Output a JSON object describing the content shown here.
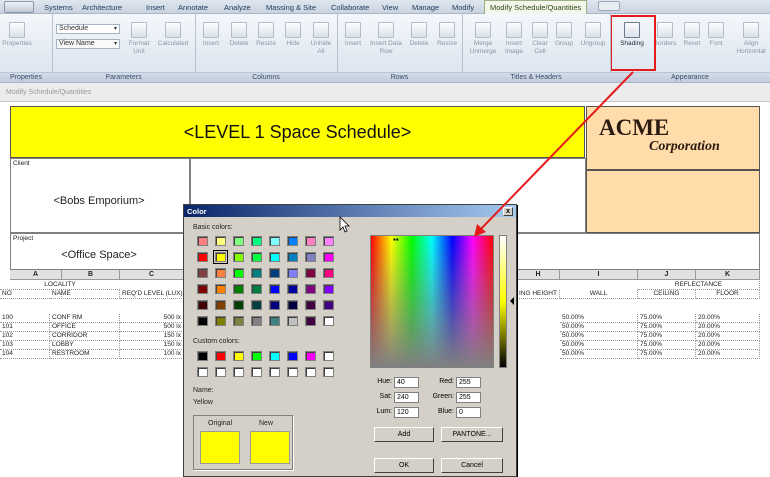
{
  "menubar": {
    "items": [
      "Systems",
      "Architecture",
      "Insert",
      "Annotate",
      "Analyze",
      "Massing & Site",
      "Collaborate",
      "View",
      "Manage",
      "Modify"
    ],
    "active": "Modify Schedule/Quantities"
  },
  "ribbon": {
    "properties_label": "Properties",
    "schedule_dropdown": "Schedule",
    "view_name_field": "View Name",
    "parameters": [
      "Format Unit",
      "Calculated"
    ],
    "columns": [
      "Insert",
      "Delete",
      "Resize",
      "Hide",
      "Unhide All"
    ],
    "rows": [
      "Insert",
      "Insert Data Row",
      "Delete",
      "Resize"
    ],
    "titles": [
      "Merge Unmerge",
      "Insert Image",
      "Clear Cell",
      "Group",
      "Ungroup"
    ],
    "appearance": [
      "Shading",
      "Borders",
      "Reset",
      "Font",
      "Align Horizontal"
    ],
    "panels": [
      "Properties",
      "Parameters",
      "Columns",
      "Rows",
      "Titles & Headers",
      "Appearance"
    ]
  },
  "context_label": "Modify Schedule/Quantities",
  "schedule": {
    "title": "<LEVEL 1 Space Schedule>",
    "logo_line1": "ACME",
    "logo_line2": "Corporation",
    "client_label": "Client",
    "client_value": "<Bobs Emporium>",
    "project_label": "Project",
    "project_value": "<Office Space>",
    "column_letters": [
      "A",
      "B",
      "C",
      "H",
      "I",
      "J",
      "K"
    ],
    "locality": "LOCALITY",
    "reflectance": "REFLECTANCE",
    "headers": [
      "NO",
      "NAME",
      "REQ'D LEVEL (LUX)",
      "ING HEIGHT",
      "WALL",
      "CEILING",
      "FLOOR"
    ],
    "rows": [
      {
        "no": "100",
        "name": "CONF RM",
        "lux": "500 lx",
        "wall": "50.00%",
        "ceiling": "75.00%",
        "floor": "20.00%"
      },
      {
        "no": "101",
        "name": "OFFICE",
        "lux": "500 lx",
        "wall": "50.00%",
        "ceiling": "75.00%",
        "floor": "20.00%"
      },
      {
        "no": "102",
        "name": "CORRIDOR",
        "lux": "150 lx",
        "wall": "50.00%",
        "ceiling": "75.00%",
        "floor": "20.00%"
      },
      {
        "no": "103",
        "name": "LOBBY",
        "lux": "150 lx",
        "wall": "50.00%",
        "ceiling": "75.00%",
        "floor": "20.00%"
      },
      {
        "no": "104",
        "name": "RESTROOM",
        "lux": "100 lx",
        "wall": "50.00%",
        "ceiling": "75.00%",
        "floor": "20.00%"
      }
    ]
  },
  "dialog": {
    "title": "Color",
    "close": "x",
    "basic_label": "Basic colors:",
    "custom_label": "Custom colors:",
    "basic_colors": [
      "#ff8080",
      "#ffff80",
      "#80ff80",
      "#00ff80",
      "#80ffff",
      "#0080ff",
      "#ff80c0",
      "#ff80ff",
      "#ff0000",
      "#ffff00",
      "#80ff00",
      "#00ff40",
      "#00ffff",
      "#0080c0",
      "#8080c0",
      "#ff00ff",
      "#804040",
      "#ff8040",
      "#00ff00",
      "#008080",
      "#004080",
      "#8080ff",
      "#800040",
      "#ff0080",
      "#800000",
      "#ff8000",
      "#008000",
      "#008040",
      "#0000ff",
      "#0000a0",
      "#800080",
      "#8000ff",
      "#400000",
      "#804000",
      "#004000",
      "#004040",
      "#000080",
      "#000040",
      "#400040",
      "#400080",
      "#000000",
      "#808000",
      "#808040",
      "#808080",
      "#408080",
      "#c0c0c0",
      "#400040",
      "#ffffff"
    ],
    "custom_colors": [
      "#000000",
      "#ff0000",
      "#ffff00",
      "#00ff00",
      "#00ffff",
      "#0000ff",
      "#ff00ff",
      "#ffffff",
      "#ffffff",
      "#ffffff",
      "#ffffff",
      "#ffffff",
      "#ffffff",
      "#ffffff",
      "#ffffff",
      "#ffffff"
    ],
    "name_label": "Name:",
    "name_value": "Yellow",
    "original_label": "Original",
    "new_label": "New",
    "original_color": "#ffff00",
    "new_color": "#ffff00",
    "hue_label": "Hue:",
    "hue": "40",
    "sat_label": "Sat:",
    "sat": "240",
    "lum_label": "Lum:",
    "lum": "120",
    "red_label": "Red:",
    "red": "255",
    "green_label": "Green:",
    "green": "255",
    "blue_label": "Blue:",
    "blue": "0",
    "add_button": "Add",
    "pantone_button": "PANTONE...",
    "ok_button": "OK",
    "cancel_button": "Cancel"
  },
  "colors": {
    "highlight": "#e31b1b",
    "title_fill": "#ffff00",
    "logo_fill": "#ffdcaa"
  }
}
